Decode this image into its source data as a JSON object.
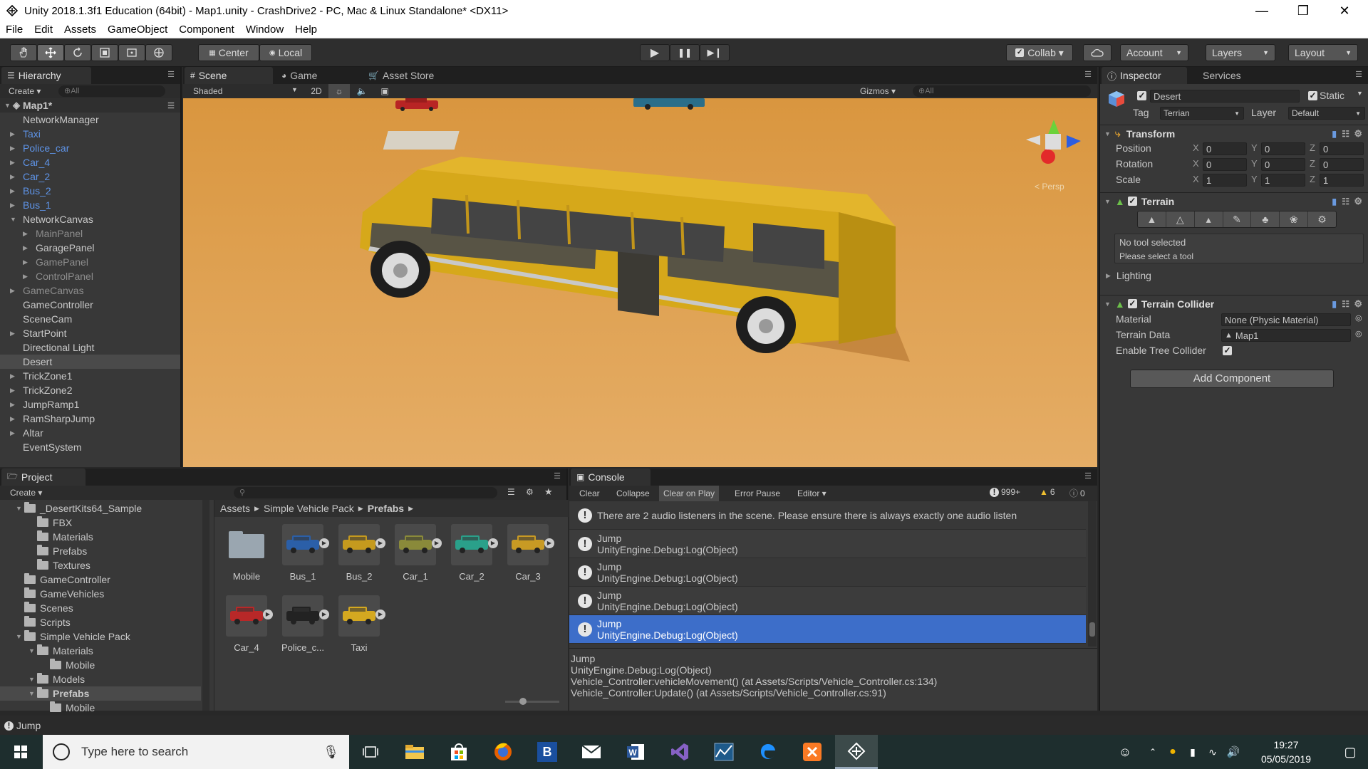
{
  "window": {
    "title": "Unity 2018.1.3f1 Education (64bit) - Map1.unity - CrashDrive2 - PC, Mac & Linux Standalone* <DX11>",
    "minimize": "—",
    "maximize": "❒",
    "close": "✕"
  },
  "menu": [
    "File",
    "Edit",
    "Assets",
    "GameObject",
    "Component",
    "Window",
    "Help"
  ],
  "toolbar": {
    "pivot": "Center",
    "space": "Local",
    "collab": "Collab ▾",
    "account": "Account",
    "layers": "Layers",
    "layout": "Layout",
    "play": "▶",
    "pause": "❚❚",
    "step": "▶❙"
  },
  "hierarchy": {
    "tab": "Hierarchy",
    "create": "Create ▾",
    "search": "⊕All",
    "scene": "Map1*",
    "items": [
      {
        "label": "NetworkManager",
        "indent": 1,
        "arrow": false,
        "color": "normal"
      },
      {
        "label": "Taxi",
        "indent": 1,
        "arrow": true,
        "color": "blue"
      },
      {
        "label": "Police_car",
        "indent": 1,
        "arrow": true,
        "color": "blue"
      },
      {
        "label": "Car_4",
        "indent": 1,
        "arrow": true,
        "color": "blue"
      },
      {
        "label": "Car_2",
        "indent": 1,
        "arrow": true,
        "color": "blue"
      },
      {
        "label": "Bus_2",
        "indent": 1,
        "arrow": true,
        "color": "blue"
      },
      {
        "label": "Bus_1",
        "indent": 1,
        "arrow": true,
        "color": "blue"
      },
      {
        "label": "NetworkCanvas",
        "indent": 1,
        "arrow": true,
        "open": true,
        "color": "normal"
      },
      {
        "label": "MainPanel",
        "indent": 2,
        "arrow": true,
        "color": "grey"
      },
      {
        "label": "GaragePanel",
        "indent": 2,
        "arrow": true,
        "color": "normal"
      },
      {
        "label": "GamePanel",
        "indent": 2,
        "arrow": true,
        "color": "grey"
      },
      {
        "label": "ControlPanel",
        "indent": 2,
        "arrow": true,
        "color": "grey"
      },
      {
        "label": "GameCanvas",
        "indent": 1,
        "arrow": true,
        "color": "grey"
      },
      {
        "label": "GameController",
        "indent": 1,
        "arrow": false,
        "color": "normal"
      },
      {
        "label": "SceneCam",
        "indent": 1,
        "arrow": false,
        "color": "normal"
      },
      {
        "label": "StartPoint",
        "indent": 1,
        "arrow": true,
        "color": "normal"
      },
      {
        "label": "Directional Light",
        "indent": 1,
        "arrow": false,
        "color": "normal"
      },
      {
        "label": "Desert",
        "indent": 1,
        "arrow": false,
        "color": "normal",
        "selected": true
      },
      {
        "label": "TrickZone1",
        "indent": 1,
        "arrow": true,
        "color": "normal"
      },
      {
        "label": "TrickZone2",
        "indent": 1,
        "arrow": true,
        "color": "normal"
      },
      {
        "label": "JumpRamp1",
        "indent": 1,
        "arrow": true,
        "color": "normal"
      },
      {
        "label": "RamSharpJump",
        "indent": 1,
        "arrow": true,
        "color": "normal"
      },
      {
        "label": "Altar",
        "indent": 1,
        "arrow": true,
        "color": "normal"
      },
      {
        "label": "EventSystem",
        "indent": 1,
        "arrow": false,
        "color": "normal"
      }
    ]
  },
  "scene": {
    "tabs": [
      "Scene",
      "Game",
      "Asset Store"
    ],
    "shading": "Shaded",
    "mode2d": "2D",
    "gizmos": "Gizmos ▾",
    "search": "⊕All",
    "persp": "< Persp"
  },
  "inspector": {
    "tabs": [
      "Inspector",
      "Services"
    ],
    "object_name": "Desert",
    "static": "Static",
    "tag_label": "Tag",
    "tag": "Terrian",
    "layer_label": "Layer",
    "layer": "Default",
    "transform": {
      "title": "Transform",
      "rows": [
        {
          "label": "Position",
          "x": "0",
          "y": "0",
          "z": "0"
        },
        {
          "label": "Rotation",
          "x": "0",
          "y": "0",
          "z": "0"
        },
        {
          "label": "Scale",
          "x": "1",
          "y": "1",
          "z": "1"
        }
      ]
    },
    "terrain": {
      "title": "Terrain",
      "no_tool": "No tool selected",
      "hint": "Please select a tool",
      "lighting": "Lighting"
    },
    "collider": {
      "title": "Terrain Collider",
      "material_label": "Material",
      "material": "None (Physic Material)",
      "data_label": "Terrain Data",
      "data": "Map1",
      "tree_label": "Enable Tree Collider"
    },
    "add_component": "Add Component"
  },
  "project": {
    "tab": "Project",
    "create": "Create ▾",
    "tree": [
      {
        "label": "_DesertKits64_Sample",
        "indent": 1,
        "arrow": true
      },
      {
        "label": "FBX",
        "indent": 2,
        "arrow": false
      },
      {
        "label": "Materials",
        "indent": 2,
        "arrow": false
      },
      {
        "label": "Prefabs",
        "indent": 2,
        "arrow": false
      },
      {
        "label": "Textures",
        "indent": 2,
        "arrow": false
      },
      {
        "label": "GameController",
        "indent": 1,
        "arrow": false
      },
      {
        "label": "GameVehicles",
        "indent": 1,
        "arrow": false
      },
      {
        "label": "Scenes",
        "indent": 1,
        "arrow": false
      },
      {
        "label": "Scripts",
        "indent": 1,
        "arrow": false
      },
      {
        "label": "Simple Vehicle Pack",
        "indent": 1,
        "arrow": true
      },
      {
        "label": "Materials",
        "indent": 2,
        "arrow": true
      },
      {
        "label": "Mobile",
        "indent": 3,
        "arrow": false
      },
      {
        "label": "Models",
        "indent": 2,
        "arrow": true
      },
      {
        "label": "Prefabs",
        "indent": 2,
        "arrow": true,
        "selected": true
      },
      {
        "label": "Mobile",
        "indent": 3,
        "arrow": false
      }
    ],
    "breadcrumb": [
      "Assets",
      "Simple Vehicle Pack",
      "Prefabs"
    ],
    "assets": [
      {
        "label": "Mobile",
        "kind": "folder",
        "color": "#9aa6b0"
      },
      {
        "label": "Bus_1",
        "kind": "vehicle",
        "color": "#2b5fa8"
      },
      {
        "label": "Bus_2",
        "kind": "vehicle",
        "color": "#c59a1e"
      },
      {
        "label": "Car_1",
        "kind": "vehicle",
        "color": "#8a8a3a"
      },
      {
        "label": "Car_2",
        "kind": "vehicle",
        "color": "#2aa08a"
      },
      {
        "label": "Car_3",
        "kind": "vehicle",
        "color": "#c89a24"
      },
      {
        "label": "Car_4",
        "kind": "vehicle",
        "color": "#b82828"
      },
      {
        "label": "Police_c...",
        "kind": "vehicle",
        "color": "#222222"
      },
      {
        "label": "Taxi",
        "kind": "vehicle",
        "color": "#d4a820"
      }
    ]
  },
  "console": {
    "tab": "Console",
    "buttons": [
      "Clear",
      "Collapse",
      "Clear on Play",
      "Error Pause",
      "Editor ▾"
    ],
    "count_info": "999+",
    "count_warn": "6",
    "count_err": "0",
    "rows": [
      {
        "line1": "There are 2 audio listeners in the scene. Please ensure there is always exactly one audio listen",
        "line2": ""
      },
      {
        "line1": "Jump",
        "line2": "UnityEngine.Debug:Log(Object)"
      },
      {
        "line1": "Jump",
        "line2": "UnityEngine.Debug:Log(Object)"
      },
      {
        "line1": "Jump",
        "line2": "UnityEngine.Debug:Log(Object)"
      },
      {
        "line1": "Jump",
        "line2": "UnityEngine.Debug:Log(Object)",
        "selected": true
      }
    ],
    "detail": [
      "Jump",
      "UnityEngine.Debug:Log(Object)",
      "Vehicle_Controller:vehicleMovement() (at Assets/Scripts/Vehicle_Controller.cs:134)",
      "Vehicle_Controller:Update() (at Assets/Scripts/Vehicle_Controller.cs:91)"
    ]
  },
  "statusbar": {
    "text": "Jump"
  },
  "taskbar": {
    "search_placeholder": "Type here to search",
    "time": "19:27",
    "date": "05/05/2019"
  },
  "colors": {
    "selection": "#3e5f96",
    "console_selected": "#3d6ec9",
    "accent_blue": "#5e93e6",
    "desert": "#d79a4f",
    "bus": "#d9ab1c"
  }
}
